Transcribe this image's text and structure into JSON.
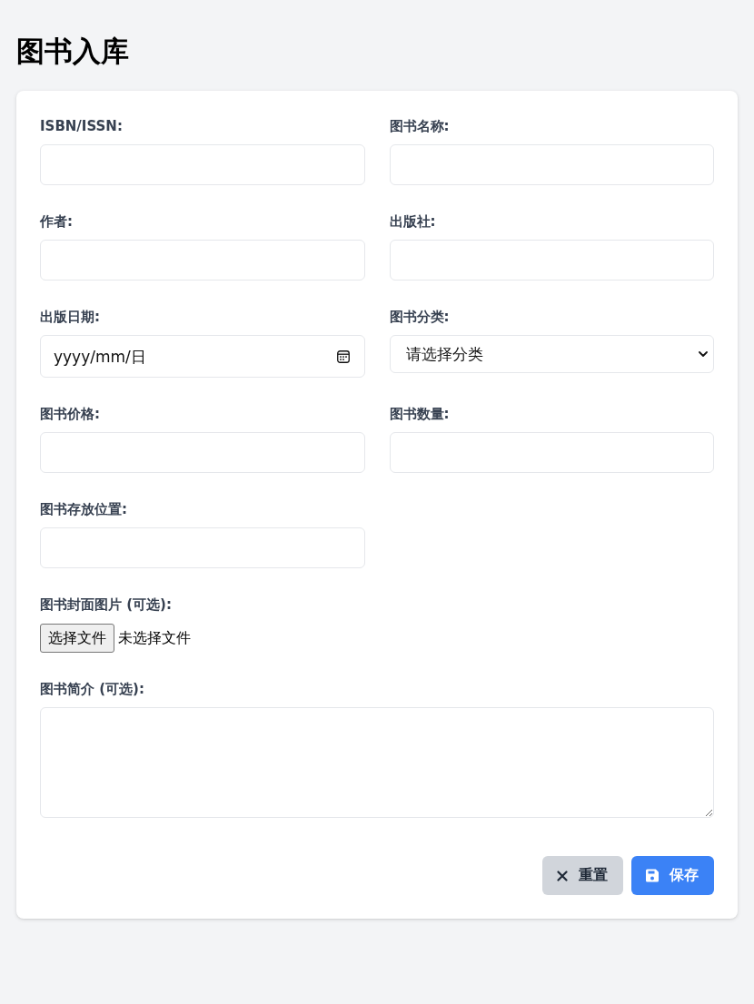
{
  "page": {
    "title": "图书入库"
  },
  "form": {
    "fields": [
      {
        "kind": "text",
        "label": "ISBN/ISSN:"
      },
      {
        "kind": "text",
        "label": "图书名称:"
      },
      {
        "kind": "text",
        "label": "作者:"
      },
      {
        "kind": "text",
        "label": "出版社:"
      },
      {
        "kind": "date",
        "label": "出版日期:",
        "placeholder": "yyyy/mm/日"
      },
      {
        "kind": "select",
        "label": "图书分类:",
        "value": "请选择分类"
      },
      {
        "kind": "text",
        "label": "图书价格:"
      },
      {
        "kind": "text",
        "label": "图书数量:"
      },
      {
        "kind": "text",
        "label": "图书存放位置:"
      },
      {
        "kind": "file",
        "label": "图书封面图片 (可选):",
        "button": "选择文件",
        "status": "未选择文件"
      },
      {
        "kind": "textarea",
        "label": "图书简介 (可选):"
      }
    ],
    "buttons": [
      {
        "kind": "reset",
        "label": "重置"
      },
      {
        "kind": "save",
        "label": "保存"
      }
    ]
  }
}
